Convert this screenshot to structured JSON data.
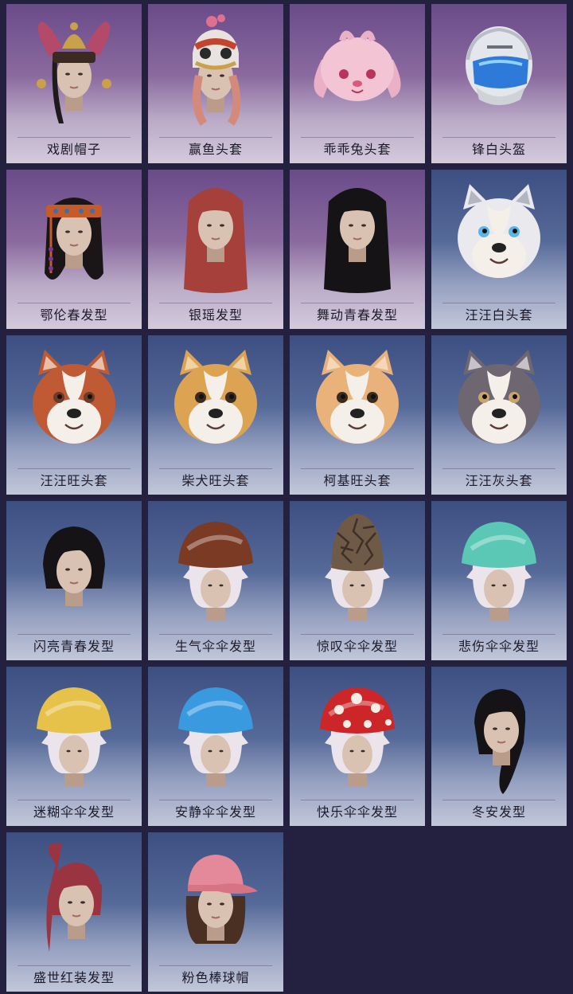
{
  "items": [
    {
      "label": "戏剧帽子",
      "theme": "purple",
      "icon": "jester-hat-icon"
    },
    {
      "label": "赢鱼头套",
      "theme": "purple",
      "icon": "fish-mask-icon"
    },
    {
      "label": "乖乖兔头套",
      "theme": "purple",
      "icon": "bunny-head-icon"
    },
    {
      "label": "锋白头盔",
      "theme": "purple",
      "icon": "moto-helmet-icon"
    },
    {
      "label": "鄂伦春发型",
      "theme": "purple",
      "icon": "headband-hair-icon"
    },
    {
      "label": "银瑶发型",
      "theme": "purple",
      "icon": "long-red-hair-icon"
    },
    {
      "label": "舞动青春发型",
      "theme": "purple",
      "icon": "black-long-hair-icon"
    },
    {
      "label": "汪汪白头套",
      "theme": "blue",
      "icon": "white-dog-head-icon"
    },
    {
      "label": "汪汪旺头套",
      "theme": "blue",
      "icon": "red-dog-head-icon"
    },
    {
      "label": "柴犬旺头套",
      "theme": "blue",
      "icon": "shiba-head-icon"
    },
    {
      "label": "柯基旺头套",
      "theme": "blue",
      "icon": "corgi-head-icon"
    },
    {
      "label": "汪汪灰头套",
      "theme": "blue",
      "icon": "gray-dog-head-icon"
    },
    {
      "label": "闪亮青春发型",
      "theme": "blue",
      "icon": "bob-hair-icon"
    },
    {
      "label": "生气伞伞发型",
      "theme": "blue",
      "icon": "brown-mushroom-hat-icon"
    },
    {
      "label": "惊叹伞伞发型",
      "theme": "blue",
      "icon": "morel-mushroom-hat-icon"
    },
    {
      "label": "悲伤伞伞发型",
      "theme": "blue",
      "icon": "teal-mushroom-hat-icon"
    },
    {
      "label": "迷糊伞伞发型",
      "theme": "blue",
      "icon": "yellow-mushroom-hat-icon"
    },
    {
      "label": "安静伞伞发型",
      "theme": "blue",
      "icon": "blue-mushroom-hat-icon"
    },
    {
      "label": "快乐伞伞发型",
      "theme": "blue",
      "icon": "red-dotted-mushroom-hat-icon"
    },
    {
      "label": "冬安发型",
      "theme": "blue",
      "icon": "ponytail-hair-icon"
    },
    {
      "label": "盛世红装发型",
      "theme": "blue",
      "icon": "red-ponytail-hair-icon"
    },
    {
      "label": "粉色棒球帽",
      "theme": "blue",
      "icon": "pink-cap-icon"
    }
  ]
}
